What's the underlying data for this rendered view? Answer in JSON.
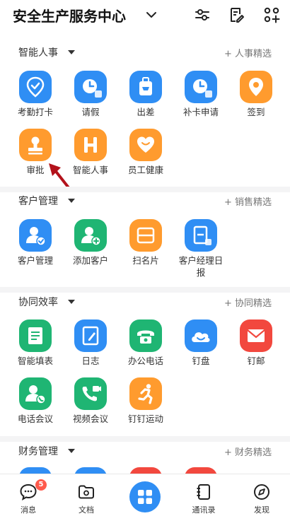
{
  "header": {
    "title": "安全生产服务中心",
    "icons": [
      "chevron-down-icon",
      "filter-settings-icon",
      "edit-list-icon",
      "grid-add-icon"
    ]
  },
  "sections": [
    {
      "title": "智能人事",
      "more": "+ 人事精选"
    },
    {
      "title": "客户管理",
      "more": "+ 销售精选"
    },
    {
      "title": "协同效率",
      "more": "+ 协同精选"
    },
    {
      "title": "财务管理",
      "more": "+ 财务精选"
    }
  ],
  "apps": {
    "hr": [
      "考勤打卡",
      "请假",
      "出差",
      "补卡申请",
      "签到",
      "审批",
      "智能人事",
      "员工健康"
    ],
    "crm": [
      "客户管理",
      "添加客户",
      "扫名片",
      "客户经理日报"
    ],
    "collab": [
      "智能填表",
      "日志",
      "办公电话",
      "钉盘",
      "钉邮",
      "电话会议",
      "视频会议",
      "钉钉运动"
    ]
  },
  "colors": {
    "blue": "#2f8ef4",
    "orange": "#ff9b2e",
    "green": "#1fb573",
    "red": "#f2483e",
    "arrow": "#b3121b"
  },
  "tabbar": {
    "messages": "消息",
    "messages_badge": "5",
    "docs": "文档",
    "contacts": "通讯录",
    "discover": "发现"
  }
}
